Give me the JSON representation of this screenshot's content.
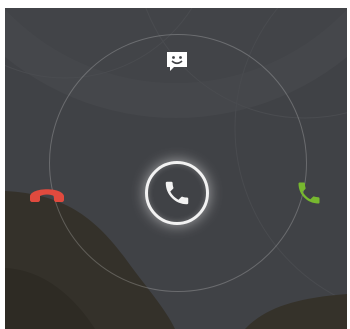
{
  "incoming_call": {
    "handle": {
      "icon": "phone-handset-icon",
      "color": "#f2f2f2"
    },
    "targets": {
      "message": {
        "icon": "chat-bubble-smiley-icon",
        "color": "#ffffff"
      },
      "decline": {
        "icon": "phone-hangup-icon",
        "color": "#e04a3e"
      },
      "answer": {
        "icon": "phone-handset-icon",
        "color": "#77b82f"
      }
    }
  },
  "colors": {
    "background": "#3f4144",
    "shadow_shape": "#322f25"
  }
}
